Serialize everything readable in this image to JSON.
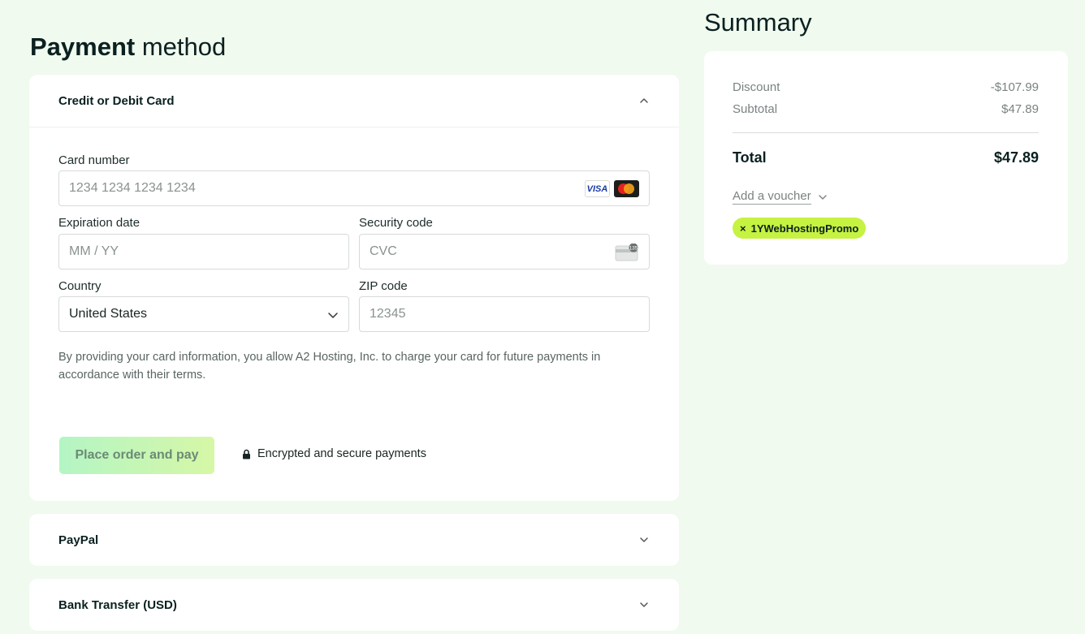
{
  "payment": {
    "title_bold": "Payment",
    "title_rest": "method",
    "credit_card": {
      "header": "Credit or Debit Card",
      "card_number_label": "Card number",
      "card_number_placeholder": "1234 1234 1234 1234",
      "visa_label": "VISA",
      "expiration_label": "Expiration date",
      "expiration_placeholder": "MM / YY",
      "security_label": "Security code",
      "security_placeholder": "CVC",
      "cvc_badge": "135",
      "country_label": "Country",
      "country_value": "United States",
      "zip_label": "ZIP code",
      "zip_placeholder": "12345",
      "legal_text": "By providing your card information, you allow A2 Hosting, Inc. to charge your card for future payments in accordance with their terms.",
      "pay_button": "Place order and pay",
      "secure_text": "Encrypted and secure payments"
    },
    "paypal_header": "PayPal",
    "bank_header": "Bank Transfer (USD)"
  },
  "summary": {
    "title": "Summary",
    "discount_label": "Discount",
    "discount_value": "-$107.99",
    "subtotal_label": "Subtotal",
    "subtotal_value": "$47.89",
    "total_label": "Total",
    "total_value": "$47.89",
    "voucher_link": "Add a voucher",
    "promo_code": "1YWebHostingPromo",
    "promo_remove": "×"
  },
  "colors": {
    "background": "#f0faef",
    "promo_chip": "#c6f241",
    "button_gradient_start": "#b4f5c5",
    "button_gradient_end": "#d6f7a6"
  }
}
